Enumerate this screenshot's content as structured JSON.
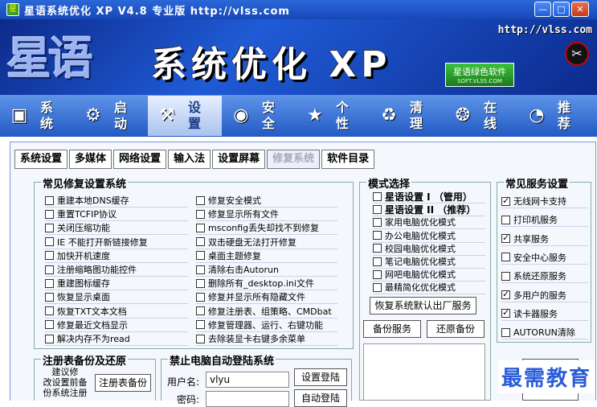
{
  "window": {
    "title": "星语系统优化 XP V4.8 专业版  http://vlss.com",
    "app_icon": "星",
    "minimize": "—",
    "maximize": "□",
    "close": "✕"
  },
  "banner": {
    "logo_text": "星语",
    "main_title": "系统优化 XP",
    "url": "http://vlss.com",
    "badge_line1": "星语绿色软件",
    "badge_line2": "SOFT.VLSS.COM",
    "tool_icon": "✂"
  },
  "nav": [
    {
      "label": "系统",
      "icon": "monitor-icon",
      "glyph": "▣"
    },
    {
      "label": "启动",
      "icon": "startup-icon",
      "glyph": "⚙"
    },
    {
      "label": "设置",
      "icon": "settings-icon",
      "glyph": "⚒"
    },
    {
      "label": "安全",
      "icon": "globe-icon",
      "glyph": "◉"
    },
    {
      "label": "个性",
      "icon": "star-icon",
      "glyph": "★"
    },
    {
      "label": "清理",
      "icon": "trash-icon",
      "glyph": "♻"
    },
    {
      "label": "在线",
      "icon": "network-icon",
      "glyph": "❂"
    },
    {
      "label": "推荐",
      "icon": "recommend-icon",
      "glyph": "◔"
    }
  ],
  "tabs": [
    "系统设置",
    "多媒体",
    "网络设置",
    "输入法",
    "设置屏幕",
    "修复系统",
    "软件目录"
  ],
  "repair": {
    "title": "常见修复设置系统",
    "left": [
      "重建本地DNS缓存",
      "重置TCFIP协议",
      "关闭压缩功能",
      "IE 不能打开新链接修复",
      "加快开机速度",
      "注册缩略图功能控件",
      "重建图标缓存",
      "恢复显示桌面",
      "恢复TXT文本文档",
      "修复最近文档显示",
      "解决内存不为read"
    ],
    "right": [
      "修复安全模式",
      "修复显示所有文件",
      "msconfig丢失却找不到修复",
      "双击硬盘无法打开修复",
      "桌面主题修复",
      "清除右击Autorun",
      "删除所有_desktop.ini文件",
      "修复并显示所有隐藏文件",
      "修复注册表、组策略、CMDbat",
      "修复管理器、运行、右键功能",
      "去除装显卡右键多余菜单"
    ]
  },
  "mode": {
    "title": "模式选择",
    "items": [
      "星语设置 I  （管用）",
      "星语设置 II  （推荐）",
      "家用电脑优化模式",
      "办公电脑优化模式",
      "校园电脑优化模式",
      "笔记电脑优化模式",
      "网吧电脑优化模式",
      "最精简化优化模式"
    ],
    "restore_default": "恢复系统默认出厂服务",
    "backup": "备份服务",
    "restore_backup": "还原备份"
  },
  "services": {
    "title": "常见服务设置",
    "items": [
      {
        "label": "无线网卡支持",
        "checked": true
      },
      {
        "label": "打印机服务",
        "checked": false
      },
      {
        "label": "共享服务",
        "checked": true
      },
      {
        "label": "安全中心服务",
        "checked": false
      },
      {
        "label": "系统还原服务",
        "checked": false
      },
      {
        "label": "多用户的服务",
        "checked": true
      },
      {
        "label": "读卡器服务",
        "checked": true
      },
      {
        "label": "AUTORUN清除",
        "checked": false
      }
    ],
    "optimize_line1": "一键",
    "optimize_line2": "优 化"
  },
  "registry": {
    "title": "注册表备份及还原",
    "note1": "建议修",
    "note2": "改设置前备",
    "note3": "份系统注册",
    "backup_button": "注册表备份"
  },
  "autologin": {
    "title": "禁止电脑自动登陆系统",
    "username_label": "用户名:",
    "username_value": "vlyu",
    "password_label": "密码:",
    "set_button": "设置登陆",
    "auto_button": "自动登陆"
  },
  "watermark": "最需教育"
}
